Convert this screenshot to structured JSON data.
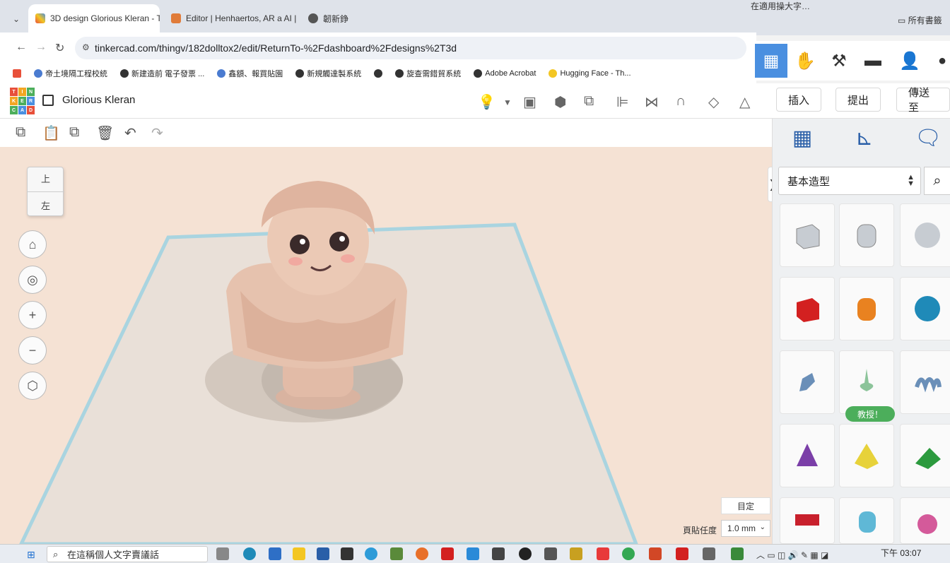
{
  "browser": {
    "tabs": [
      {
        "label": "3D design Glorious Kleran - T",
        "close": "✕",
        "active": true
      },
      {
        "label": "Editor | Henhaertos, AR a AI |",
        "close": "✕",
        "active": false
      },
      {
        "label": "韌新錚",
        "close": "",
        "active": false
      }
    ],
    "top_notice": "在適用操大字…",
    "all_bookmarks": "所有書籤",
    "url": "tinkercad.com/thingv/182dolltox2/edit/ReturnTo-%2Fdashboard%2Fdesigns%2T3d",
    "bookmarks": [
      "帝土境隔工程校統",
      "新建造前 電子發票 ...",
      "鑫額、報買貼園",
      "新規觸達製系統",
      "",
      "旋查需錯貿系統",
      "Adobe Acrobat",
      "Hugging Face - Th..."
    ]
  },
  "tinkercad": {
    "design_title": "Glorious Kleran",
    "logo_letters": [
      "T",
      "I",
      "N",
      "K",
      "E",
      "R",
      "C",
      "A",
      "D"
    ],
    "header_buttons": {
      "import": "插入",
      "export": "提出",
      "send_to": "傳送至"
    },
    "viewcube": {
      "top": "上",
      "front": "左"
    },
    "edit_grid": "目定",
    "snap_label": "頁貼任度",
    "snap_value": "1.0 mm",
    "collapse_arrow": "❯"
  },
  "panel": {
    "shape_category": "基本造型",
    "teach_badge": "教授！"
  },
  "taskbar": {
    "search_placeholder": "在這稱個人文字賣議話",
    "clock": "下午 03:07"
  },
  "colors": {
    "workplane_bg": "#f5e2d4",
    "accent_blue": "#4a8fe0",
    "badge_green": "#4cae5b"
  }
}
